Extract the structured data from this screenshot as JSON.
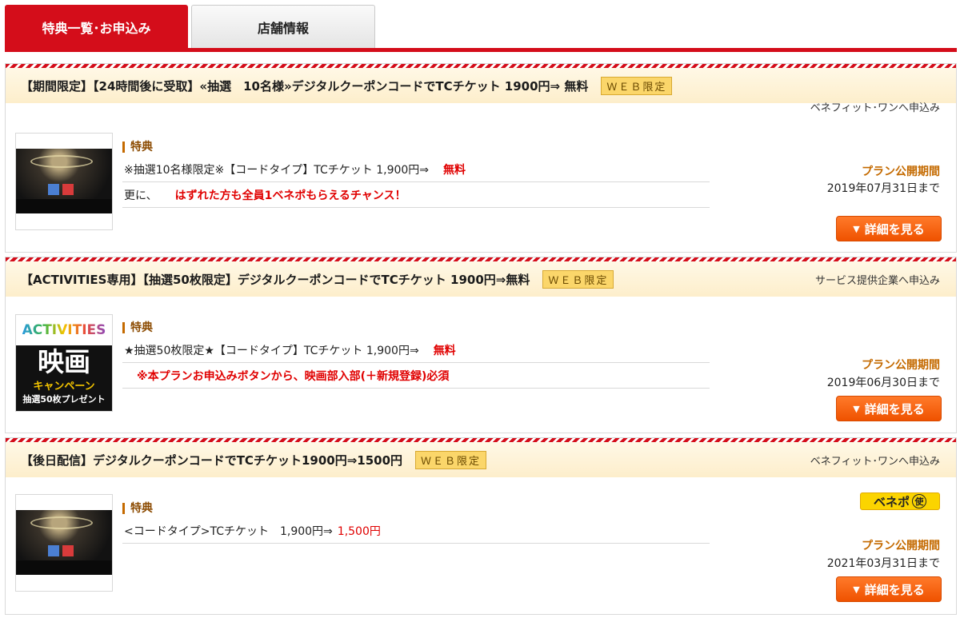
{
  "tabs": [
    {
      "label": "特典一覧･お申込み",
      "active": true
    },
    {
      "label": "店舗情報",
      "active": false
    }
  ],
  "colors": {
    "primary": "#d40d1a",
    "accent_orange": "#ef5200",
    "badge_yellow": "#fbd66a"
  },
  "cards": [
    {
      "title": "【期間限定】【24時間後に受取】«抽選　10名様»デジタルクーポンコードでTCチケット 1900円⇒ 無料",
      "badge": "ＷＥＢ限定",
      "apply_link": "ベネフィット･ワンへ申込み",
      "thumbnail": "movie-theater-image",
      "benefit_label": "特典",
      "benefit_rows": [
        {
          "text": "※抽選10名様限定※【コードタイプ】TCチケット 1,900円⇒",
          "highlight": "無料"
        },
        {
          "text": "更に、",
          "highlight": "はずれた方も全員1ベネポもらえるチャンス！"
        }
      ],
      "period_label": "プラン公開期間",
      "period_date": "2019年07月31日まで",
      "detail_button": "詳細を見る"
    },
    {
      "title": "【ACTIVITIES専用】【抽選50枚限定】デジタルクーポンコードでTCチケット 1900円⇒無料",
      "badge": "ＷＥＢ限定",
      "apply_link": "サービス提供企業へ申込み",
      "thumbnail": "activities-campaign-image",
      "thumbnail_text": {
        "top": "ACTIVITIES",
        "main": "映画",
        "sub": "キャンペーン",
        "bottom": "抽選50枚プレゼント"
      },
      "benefit_label": "特典",
      "benefit_rows": [
        {
          "text": "★抽選50枚限定★【コードタイプ】TCチケット 1,900円⇒",
          "highlight": "無料"
        },
        {
          "text": "",
          "highlight": "※本プランお申込みボタンから、映画部入部(＋新規登録)必須"
        }
      ],
      "period_label": "プラン公開期間",
      "period_date": "2019年06月30日まで",
      "detail_button": "詳細を見る"
    },
    {
      "title": "【後日配信】デジタルクーポンコードでTCチケット1900円⇒1500円",
      "badge": "ＷＥＢ限定",
      "apply_link": "ベネフィット･ワンへ申込み",
      "thumbnail": "movie-theater-image",
      "benefit_label": "特典",
      "benefit_rows": [
        {
          "text": "<コードタイプ>TCチケット　1,900円⇒",
          "highlight": "1,500円"
        }
      ],
      "beneporu_badge": {
        "label": "ベネポ",
        "mark": "使"
      },
      "period_label": "プラン公開期間",
      "period_date": "2021年03月31日まで",
      "detail_button": "詳細を見る"
    }
  ]
}
